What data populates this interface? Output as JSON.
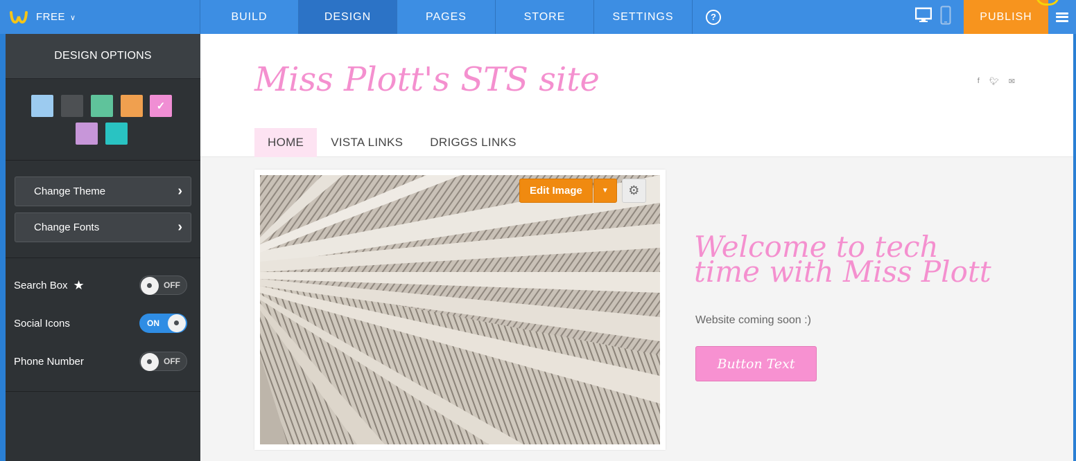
{
  "topbar": {
    "plan_label": "FREE",
    "tabs": [
      {
        "label": "BUILD",
        "active": false
      },
      {
        "label": "DESIGN",
        "active": true
      },
      {
        "label": "PAGES",
        "active": false
      },
      {
        "label": "STORE",
        "active": false
      },
      {
        "label": "SETTINGS",
        "active": false
      }
    ],
    "help_label": "?",
    "publish_label": "PUBLISH"
  },
  "sidebar": {
    "header": "DESIGN OPTIONS",
    "swatches": [
      {
        "color": "#9ccbf0",
        "selected": false
      },
      {
        "color": "#4d5053",
        "selected": false
      },
      {
        "color": "#5fc39b",
        "selected": false
      },
      {
        "color": "#f0a04f",
        "selected": false
      },
      {
        "color": "#f08ed4",
        "selected": true
      },
      {
        "color": "#c796d9",
        "selected": false
      },
      {
        "color": "#29c3c2",
        "selected": false
      }
    ],
    "buttons": [
      {
        "label": "Change Theme"
      },
      {
        "label": "Change Fonts"
      }
    ],
    "toggles": [
      {
        "label": "Search Box",
        "state": "OFF",
        "premium": true
      },
      {
        "label": "Social Icons",
        "state": "ON",
        "premium": false
      },
      {
        "label": "Phone Number",
        "state": "OFF",
        "premium": false
      }
    ]
  },
  "site": {
    "title": "Miss Plott's STS site",
    "social_icons": [
      "facebook-icon",
      "twitter-icon",
      "email-icon"
    ],
    "nav": [
      {
        "label": "HOME",
        "active": true
      },
      {
        "label": "VISTA LINKS",
        "active": false
      },
      {
        "label": "DRIGGS LINKS",
        "active": false
      }
    ],
    "edit_image_label": "Edit Image",
    "headline": "Welcome to tech time with Miss Plott",
    "subtext": "Website coming soon :)",
    "button_text": "Button Text"
  },
  "colors": {
    "accent_blue": "#3d8ee3",
    "publish_orange": "#f7941e",
    "brand_pink": "#f490cf"
  }
}
